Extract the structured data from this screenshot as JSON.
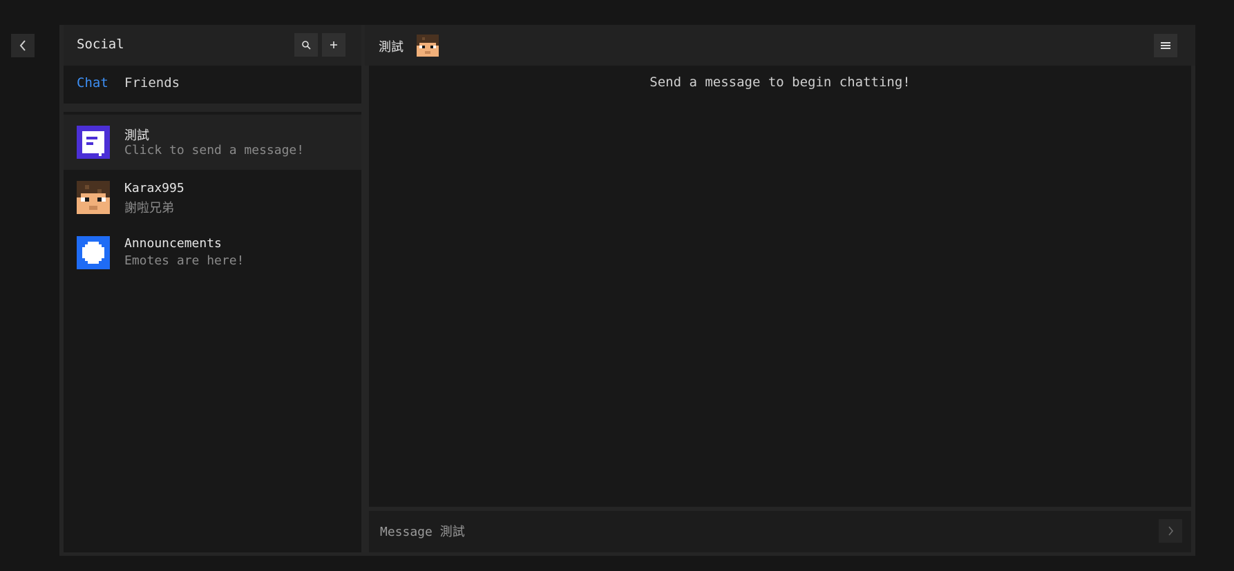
{
  "nav": {
    "back_icon": "chevron-left-icon"
  },
  "sidebar": {
    "title": "Social",
    "search_icon": "search-icon",
    "add_icon": "plus-icon",
    "tabs": [
      {
        "label": "Chat",
        "active": true
      },
      {
        "label": "Friends",
        "active": false
      }
    ],
    "conversations": [
      {
        "name": "測試",
        "preview": "Click to send a message!",
        "avatar": "group-chat-icon",
        "selected": true
      },
      {
        "name": "Karax995",
        "preview": "謝啦兄弟",
        "avatar": "player-skin-avatar",
        "selected": false
      },
      {
        "name": "Announcements",
        "preview": "Emotes are here!",
        "avatar": "announcement-logo-icon",
        "selected": false
      }
    ]
  },
  "chat": {
    "title": "測試",
    "header_avatar": "player-skin-avatar",
    "menu_icon": "hamburger-menu-icon",
    "empty_hint": "Send a message to begin chatting!",
    "composer_placeholder": "Message 測試",
    "send_icon": "chevron-right-icon"
  },
  "colors": {
    "accent": "#3d8ff5",
    "background": "#161616",
    "panel": "#181818",
    "header": "#222222",
    "group_avatar": "#4b2fd6",
    "announcement_avatar": "#1f6cf5"
  }
}
